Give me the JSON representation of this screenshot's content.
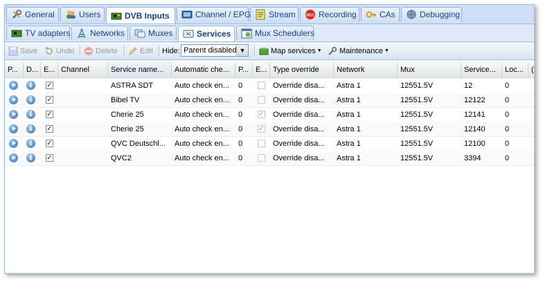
{
  "main_tabs": [
    {
      "label": "General",
      "icon": "wrench-icon"
    },
    {
      "label": "Users",
      "icon": "users-icon"
    },
    {
      "label": "DVB Inputs",
      "icon": "dvb-card-icon",
      "active": true
    },
    {
      "label": "Channel / EPG",
      "icon": "tv-icon"
    },
    {
      "label": "Stream",
      "icon": "stream-icon"
    },
    {
      "label": "Recording",
      "icon": "rec-icon"
    },
    {
      "label": "CAs",
      "icon": "key-icon"
    },
    {
      "label": "Debugging",
      "icon": "bug-icon"
    }
  ],
  "sub_tabs": [
    {
      "label": "TV adapters",
      "icon": "adapter-icon"
    },
    {
      "label": "Networks",
      "icon": "antenna-icon"
    },
    {
      "label": "Muxes",
      "icon": "muxes-icon"
    },
    {
      "label": "Services",
      "icon": "services-icon",
      "active": true
    },
    {
      "label": "Mux Schedulers",
      "icon": "calendar-icon"
    }
  ],
  "toolbar": {
    "save": "Save",
    "undo": "Undo",
    "delete": "Delete",
    "edit": "Edit",
    "hide_label": "Hide:",
    "hide_value": "Parent disabled",
    "map_services": "Map services",
    "maintenance": "Maintenance"
  },
  "columns": [
    "P...",
    "D...",
    "E...",
    "Channel",
    "Service name...",
    "Automatic che...",
    "P...",
    "E...",
    "Type override",
    "Network",
    "Mux",
    "Service...",
    "Loc...",
    "("
  ],
  "rows": [
    {
      "enabled": true,
      "channel": "",
      "service": "ASTRA SDT",
      "auto": "Auto check en...",
      "p": "0",
      "e": false,
      "override": "Override disa...",
      "network": "Astra 1",
      "mux": "12551.5V",
      "sid": "12",
      "loc": "0"
    },
    {
      "enabled": true,
      "channel": "",
      "service": "Bibel TV",
      "auto": "Auto check en...",
      "p": "0",
      "e": false,
      "override": "Override disa...",
      "network": "Astra 1",
      "mux": "12551.5V",
      "sid": "12122",
      "loc": "0"
    },
    {
      "enabled": true,
      "channel": "",
      "service": "Cherie 25",
      "auto": "Auto check en...",
      "p": "0",
      "e": true,
      "override": "Override disa...",
      "network": "Astra 1",
      "mux": "12551.5V",
      "sid": "12141",
      "loc": "0"
    },
    {
      "enabled": true,
      "channel": "",
      "service": "Cherie 25",
      "auto": "Auto check en...",
      "p": "0",
      "e": true,
      "override": "Override disa...",
      "network": "Astra 1",
      "mux": "12551.5V",
      "sid": "12140",
      "loc": "0"
    },
    {
      "enabled": true,
      "channel": "",
      "service": "QVC Deutschl...",
      "auto": "Auto check en...",
      "p": "0",
      "e": false,
      "override": "Override disa...",
      "network": "Astra 1",
      "mux": "12551.5V",
      "sid": "12100",
      "loc": "0"
    },
    {
      "enabled": true,
      "channel": "",
      "service": "QVC2",
      "auto": "Auto check en...",
      "p": "0",
      "e": false,
      "override": "Override disa...",
      "network": "Astra 1",
      "mux": "12551.5V",
      "sid": "3394",
      "loc": "0"
    }
  ],
  "colors": {
    "accent": "#15428b",
    "border": "#99bbe8",
    "panel": "#dfe8f6"
  }
}
